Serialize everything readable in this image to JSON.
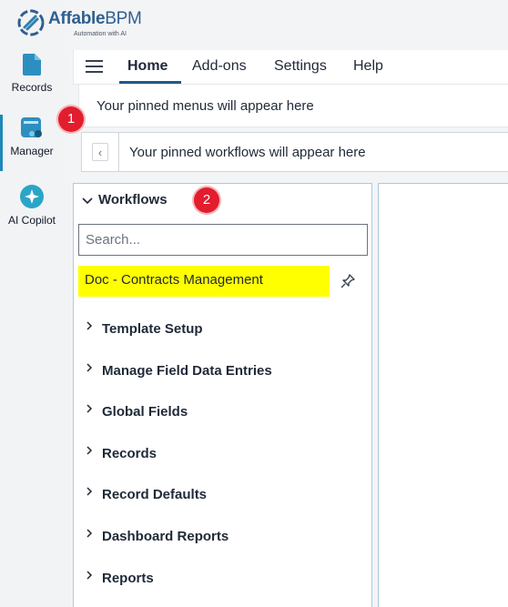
{
  "brand": {
    "name_part1": "Affable",
    "name_part2": "BPM",
    "tagline": "Automation with AI",
    "color": "#2f5f8f"
  },
  "rail": {
    "items": [
      {
        "label": "Records",
        "icon": "records-icon"
      },
      {
        "label": "Manager",
        "icon": "manager-icon",
        "active": true
      },
      {
        "label": "AI Copilot",
        "icon": "ai-copilot-icon"
      }
    ]
  },
  "topnav": {
    "tabs": [
      {
        "label": "Home",
        "active": true
      },
      {
        "label": "Add-ons"
      },
      {
        "label": "Settings"
      },
      {
        "label": "Help"
      }
    ]
  },
  "pinned": {
    "menus_text": "Your pinned menus will appear here",
    "workflows_text": "Your pinned workflows will appear here"
  },
  "workflows": {
    "title": "Workflows",
    "search_placeholder": "Search...",
    "highlighted_item": "Doc - Contracts Management",
    "items": [
      "Template Setup",
      "Manage Field Data Entries",
      "Global Fields",
      "Records",
      "Record Defaults",
      "Dashboard Reports",
      "Reports"
    ]
  },
  "badges": [
    "1",
    "2"
  ],
  "colors": {
    "accent": "#1e88b6",
    "badge": "#e11d2e",
    "highlight": "#ffff00",
    "panel_border": "#a8cde0"
  }
}
